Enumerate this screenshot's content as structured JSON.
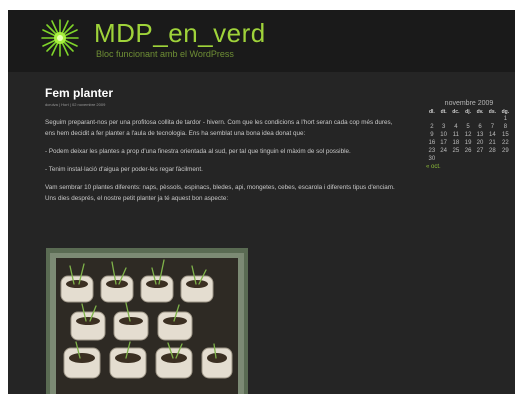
{
  "site": {
    "title": "MDP_en_verd",
    "description": "Bloc funcionant amb el WordPress"
  },
  "post": {
    "title": "Fem planter",
    "meta": "dcruiva | Hort | 02 novembre 2009",
    "paragraphs": [
      "Seguim preparant-nos per una profitosa collita de tardor - hivern. Com que les condicions a l'hort seran cada cop més dures, ens hem decidit a fer planter a l'aula de tecnologia. Ens ha semblat una bona idea donat que:",
      "- Podem deixar les plantes a prop d'una finestra orientada al sud, per tal que tinguin el màxim de sol possible.",
      "- Tenim instal·lació d'aigua per poder-les regar fàcilment.",
      "Vam sembrar 10 plantes diferents: naps, pèssols, espinacs, bledes, api, mongetes, cebes, escarola i diferents tipus d'enciam. Uns dies després, el nostre petit planter ja té aquest bon aspecte:"
    ]
  },
  "calendar": {
    "caption": "novembre 2009",
    "headers": [
      "dl.",
      "dt.",
      "dc.",
      "dj.",
      "dv.",
      "ds.",
      "dg."
    ],
    "weeks": [
      [
        "",
        "",
        "",
        "",
        "",
        "",
        "1"
      ],
      [
        "2",
        "3",
        "4",
        "5",
        "6",
        "7",
        "8"
      ],
      [
        "9",
        "10",
        "11",
        "12",
        "13",
        "14",
        "15"
      ],
      [
        "16",
        "17",
        "18",
        "19",
        "20",
        "21",
        "22"
      ],
      [
        "23",
        "24",
        "25",
        "26",
        "27",
        "28",
        "29"
      ],
      [
        "30",
        "",
        "",
        "",
        "",
        "",
        ""
      ]
    ],
    "prev_link": "« oct."
  },
  "colors": {
    "accent": "#9fd33a",
    "background": "#252525"
  },
  "icons": {
    "logo": "green-starburst-icon"
  }
}
